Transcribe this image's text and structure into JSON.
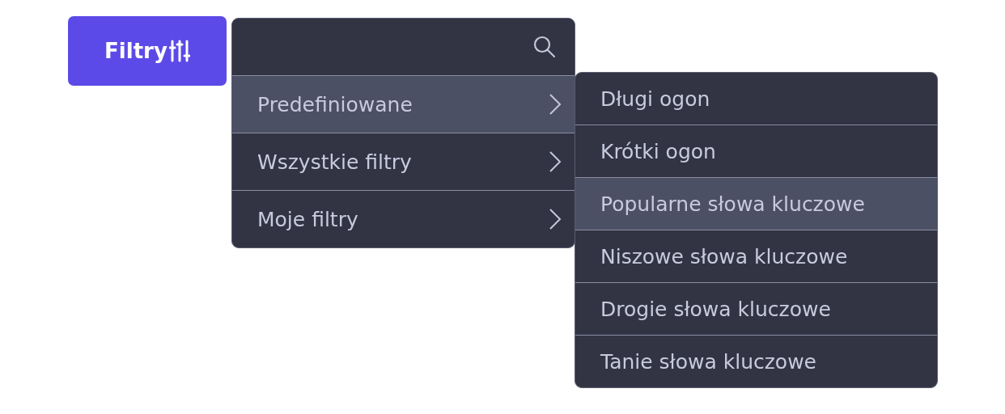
{
  "filter_button": {
    "label": "Filtry"
  },
  "menu": {
    "items": [
      {
        "label": "Predefiniowane",
        "selected": true
      },
      {
        "label": "Wszystkie filtry",
        "selected": false
      },
      {
        "label": "Moje filtry",
        "selected": false
      }
    ]
  },
  "submenu": {
    "items": [
      {
        "label": "Długi ogon",
        "selected": false
      },
      {
        "label": "Krótki ogon",
        "selected": false
      },
      {
        "label": "Popularne słowa kluczowe",
        "selected": true
      },
      {
        "label": "Niszowe słowa kluczowe",
        "selected": false
      },
      {
        "label": "Drogie słowa kluczowe",
        "selected": false
      },
      {
        "label": "Tanie słowa kluczowe",
        "selected": false
      }
    ]
  }
}
